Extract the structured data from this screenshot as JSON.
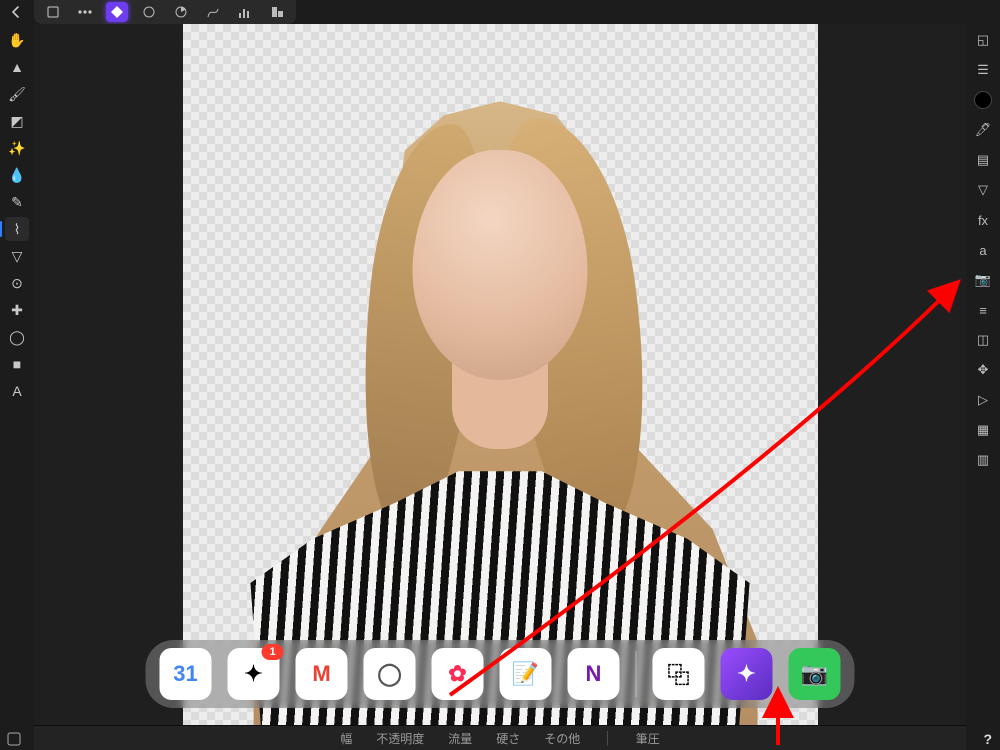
{
  "back_icon": "←",
  "persona_chip": {
    "items": [
      "document",
      "more",
      "persona",
      "draw",
      "liquify",
      "spiral",
      "histogram",
      "export"
    ],
    "selected_index": 2
  },
  "left_tools": [
    {
      "name": "hand-tool",
      "glyph": "✋"
    },
    {
      "name": "move-tool",
      "glyph": "▲"
    },
    {
      "name": "paint-brush",
      "glyph": "🖌"
    },
    {
      "name": "crop-tool",
      "glyph": "◩"
    },
    {
      "name": "flood-select",
      "glyph": "✨"
    },
    {
      "name": "color-picker",
      "glyph": "💧"
    },
    {
      "name": "pencil",
      "glyph": "✎"
    },
    {
      "name": "selection-brush",
      "glyph": "⌇",
      "selected": true
    },
    {
      "name": "burn",
      "glyph": "▽"
    },
    {
      "name": "stamp",
      "glyph": "⊙"
    },
    {
      "name": "healing",
      "glyph": "✚"
    },
    {
      "name": "dodge",
      "glyph": "◯"
    },
    {
      "name": "rectangle",
      "glyph": "■"
    },
    {
      "name": "text-tool",
      "glyph": "A"
    }
  ],
  "right_tools": [
    {
      "name": "navigator",
      "glyph": "◱"
    },
    {
      "name": "layers",
      "glyph": "☰"
    },
    {
      "name": "color",
      "glyph": "●",
      "kind": "swatch"
    },
    {
      "name": "brushes",
      "glyph": "🖊"
    },
    {
      "name": "channels",
      "glyph": "▤"
    },
    {
      "name": "adjustments",
      "glyph": "▽"
    },
    {
      "name": "effects",
      "glyph": "fx"
    },
    {
      "name": "styles",
      "glyph": "a"
    },
    {
      "name": "stock",
      "glyph": "📷"
    },
    {
      "name": "transform",
      "glyph": "≡"
    },
    {
      "name": "history",
      "glyph": "◫"
    },
    {
      "name": "snapping",
      "glyph": "✥"
    },
    {
      "name": "macro",
      "glyph": "▷"
    },
    {
      "name": "swatches-grid",
      "glyph": "▦"
    },
    {
      "name": "metadata",
      "glyph": "▥"
    }
  ],
  "context_bar": [
    {
      "key": "width",
      "label": "幅"
    },
    {
      "key": "opacity",
      "label": "不透明度"
    },
    {
      "key": "flow",
      "label": "流量"
    },
    {
      "key": "hardness",
      "label": "硬さ"
    },
    {
      "key": "more",
      "label": "その他"
    },
    {
      "key": "pressure",
      "label": "筆圧"
    }
  ],
  "dock": [
    {
      "name": "calendar",
      "label": "31",
      "badge": null,
      "bg": "white",
      "fg": "#4285f4"
    },
    {
      "name": "google-photos",
      "label": "✦",
      "badge": "1",
      "bg": "white",
      "fg": "#000"
    },
    {
      "name": "gmail",
      "label": "M",
      "badge": null,
      "bg": "white",
      "fg": "#ea4335"
    },
    {
      "name": "chrome",
      "label": "◯",
      "badge": null,
      "bg": "white",
      "fg": "#555"
    },
    {
      "name": "apple-photos",
      "label": "✿",
      "badge": null,
      "bg": "white",
      "fg": "#ff2d55"
    },
    {
      "name": "goodnotes",
      "label": "📝",
      "badge": null,
      "bg": "white",
      "fg": "#2a6"
    },
    {
      "name": "onenote",
      "label": "N",
      "badge": null,
      "bg": "white",
      "fg": "#7719aa"
    },
    {
      "name": "unsplash",
      "label": "⿻",
      "badge": null,
      "bg": "white",
      "fg": "#000",
      "after_sep": true
    },
    {
      "name": "affinity-photo",
      "label": "✦",
      "badge": null,
      "bg": "purple",
      "fg": "#fff"
    },
    {
      "name": "camera-app",
      "label": "📷",
      "badge": null,
      "bg": "green",
      "fg": "#fff"
    }
  ],
  "help": "?",
  "arrow_note": "annotation-arrows"
}
